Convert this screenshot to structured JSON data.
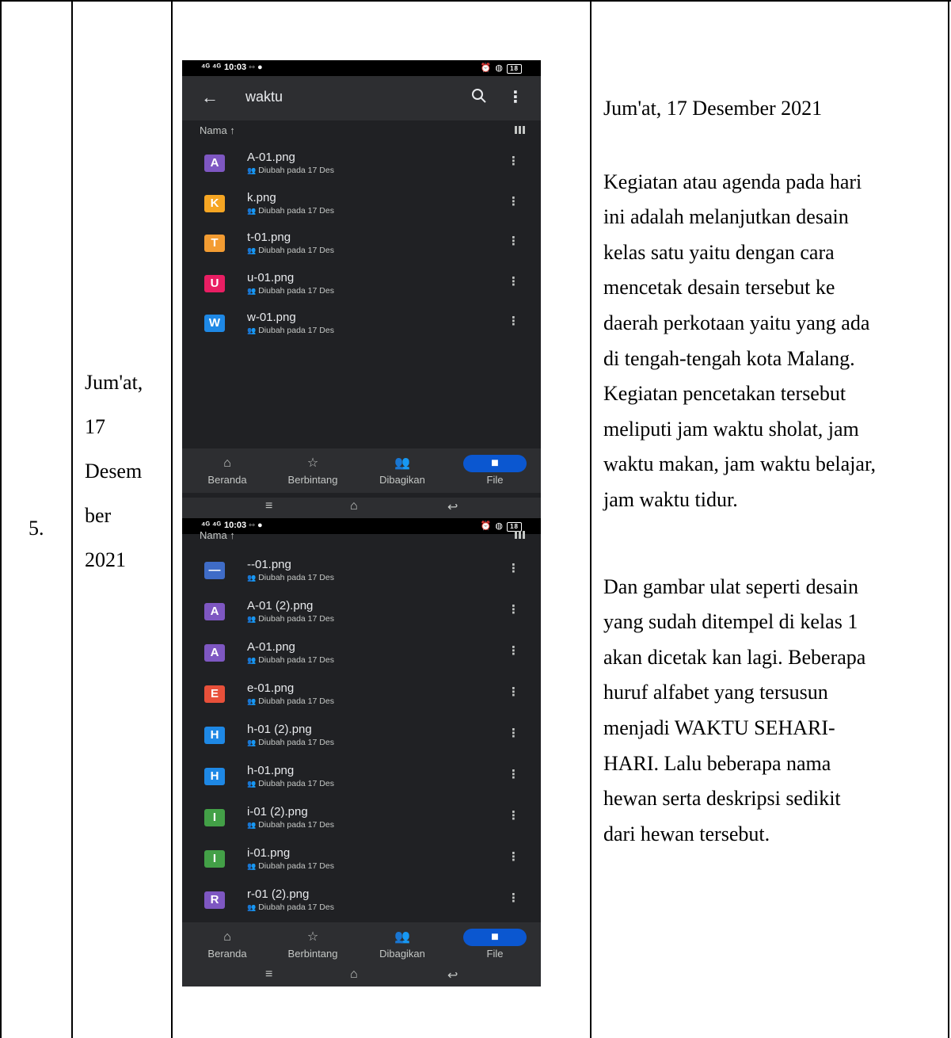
{
  "row_number": "5.",
  "date_cell": [
    "Jum'at,",
    "17",
    "Desem",
    "ber",
    "2021"
  ],
  "journal": {
    "date": "Jum'at, 17 Desember 2021",
    "paragraph1": [
      "Kegiatan atau agenda pada hari",
      "ini adalah melanjutkan desain",
      "kelas satu yaitu dengan cara",
      "mencetak desain tersebut ke",
      "daerah perkotaan yaitu yang ada",
      "di tengah-tengah kota Malang.",
      "Kegiatan pencetakan tersebut",
      "meliputi jam waktu sholat, jam",
      "waktu makan, jam waktu belajar,",
      "jam waktu tidur."
    ],
    "paragraph2": [
      "Dan gambar ulat seperti desain",
      "yang sudah ditempel di kelas 1",
      "akan dicetak kan lagi. Beberapa",
      "huruf alfabet yang tersusun",
      "menjadi WAKTU SEHARI-",
      "HARI. Lalu beberapa nama",
      "hewan serta deskripsi sedikit",
      "dari hewan tersebut."
    ]
  },
  "phone_top": {
    "status_time": "10:03",
    "status_left": "⁴ᴳ ⁴ᴳ",
    "folder_title": "waktu",
    "sort_label": "Nama ↑",
    "files": [
      {
        "letter": "A",
        "name": "A-01.png",
        "meta": "Diubah pada 17 Des",
        "color": "#7e57c2"
      },
      {
        "letter": "K",
        "name": "k.png",
        "meta": "Diubah pada 17 Des",
        "color": "#f6a623"
      },
      {
        "letter": "T",
        "name": "t-01.png",
        "meta": "Diubah pada 17 Des",
        "color": "#f39c32"
      },
      {
        "letter": "U",
        "name": "u-01.png",
        "meta": "Diubah pada 17 Des",
        "color": "#e91e63"
      },
      {
        "letter": "W",
        "name": "w-01.png",
        "meta": "Diubah pada 17 Des",
        "color": "#1e88e5"
      }
    ],
    "nav": [
      "Beranda",
      "Berbintang",
      "Dibagikan",
      "File"
    ]
  },
  "phone_bottom": {
    "status_time": "10:03",
    "status_left": "⁴ᴳ ⁴ᴳ",
    "sort_label": "Nama ↑",
    "files": [
      {
        "letter": "—",
        "name": "--01.png",
        "meta": "Diubah pada 17 Des",
        "color": "#3f6cc7"
      },
      {
        "letter": "A",
        "name": "A-01 (2).png",
        "meta": "Diubah pada 17 Des",
        "color": "#7e57c2"
      },
      {
        "letter": "A",
        "name": "A-01.png",
        "meta": "Diubah pada 17 Des",
        "color": "#7e57c2"
      },
      {
        "letter": "E",
        "name": "e-01.png",
        "meta": "Diubah pada 17 Des",
        "color": "#e8503a"
      },
      {
        "letter": "H",
        "name": "h-01 (2).png",
        "meta": "Diubah pada 17 Des",
        "color": "#1e88e5"
      },
      {
        "letter": "H",
        "name": "h-01.png",
        "meta": "Diubah pada 17 Des",
        "color": "#1e88e5"
      },
      {
        "letter": "I",
        "name": "i-01 (2).png",
        "meta": "Diubah pada 17 Des",
        "color": "#43a047"
      },
      {
        "letter": "I",
        "name": "i-01.png",
        "meta": "Diubah pada 17 Des",
        "color": "#43a047"
      },
      {
        "letter": "R",
        "name": "r-01 (2).png",
        "meta": "Diubah pada 17 Des",
        "color": "#7e57c2"
      }
    ],
    "nav": [
      "Beranda",
      "Berbintang",
      "Dibagikan",
      "File"
    ]
  }
}
